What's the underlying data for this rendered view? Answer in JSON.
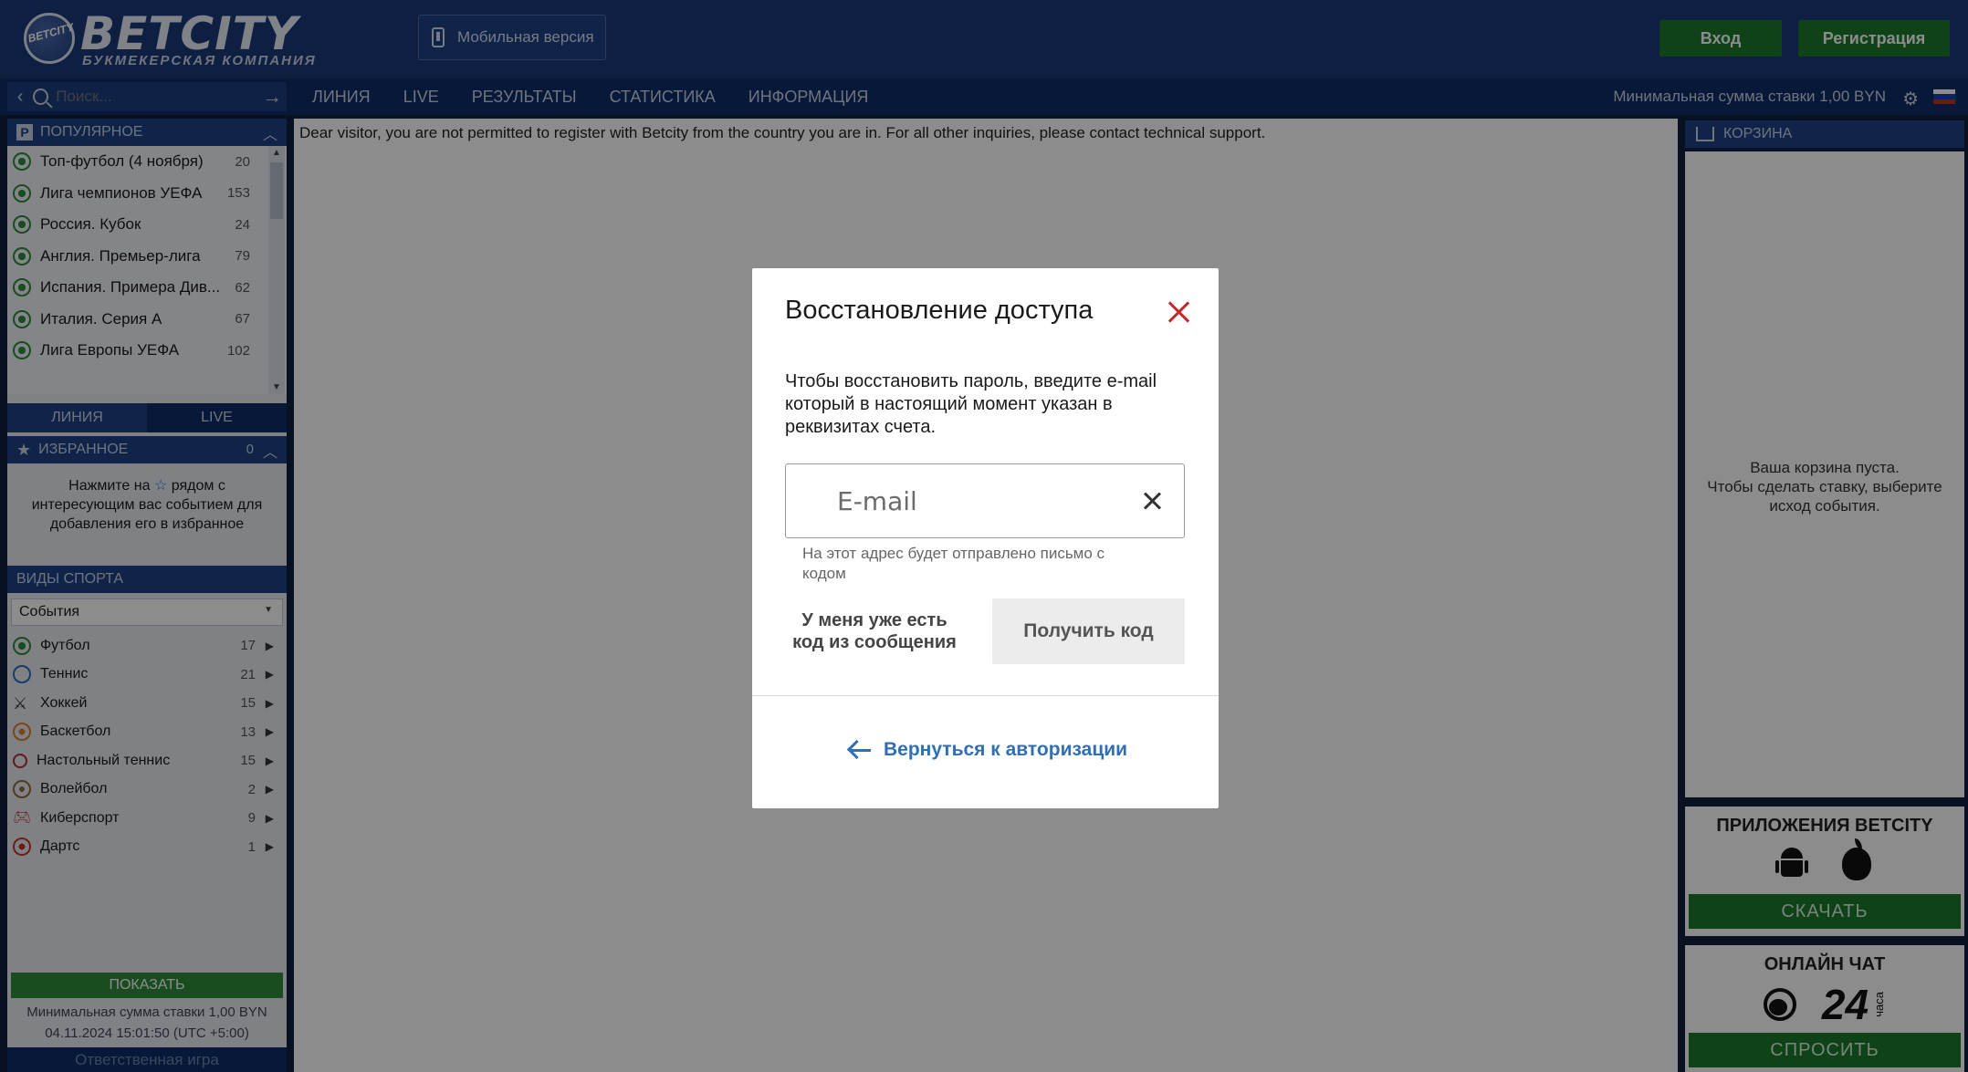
{
  "header": {
    "brand": "BETCITY",
    "tagline": "БУКМЕКЕРСКАЯ КОМПАНИЯ",
    "ball_text": "BETCITY",
    "mobile_version": "Мобильная версия",
    "login": "Вход",
    "register": "Регистрация"
  },
  "nav": {
    "search_placeholder": "Поиск...",
    "items": [
      "ЛИНИЯ",
      "LIVE",
      "РЕЗУЛЬТАТЫ",
      "СТАТИСТИКА",
      "ИНФОРМАЦИЯ"
    ],
    "min_bet": "Минимальная сумма ставки 1,00 BYN",
    "icons": [
      "gear-icon",
      "flag-ru-icon"
    ]
  },
  "popular": {
    "title": "ПОПУЛЯРНОЕ",
    "items": [
      {
        "label": "Топ-футбол (4 ноября)",
        "count": "20"
      },
      {
        "label": "Лига чемпионов УЕФА",
        "count": "153"
      },
      {
        "label": "Россия. Кубок",
        "count": "24"
      },
      {
        "label": "Англия. Премьер-лига",
        "count": "79"
      },
      {
        "label": "Испания. Примера Див...",
        "count": "62"
      },
      {
        "label": "Италия. Серия А",
        "count": "67"
      },
      {
        "label": "Лига Европы УЕФА",
        "count": "102"
      }
    ]
  },
  "tabs": {
    "line": "ЛИНИЯ",
    "live": "LIVE"
  },
  "favorites": {
    "title": "ИЗБРАННОЕ",
    "count": "0",
    "hint_1": "Нажмите на",
    "hint_2": "рядом с интересующим вас событием для добавления его в избранное"
  },
  "sports": {
    "title": "ВИДЫ СПОРТА",
    "select_value": "События",
    "items": [
      {
        "label": "Футбол",
        "count": "17",
        "color": "#2e8b3a"
      },
      {
        "label": "Теннис",
        "count": "21",
        "color": "#2f6fba"
      },
      {
        "label": "Хоккей",
        "count": "15",
        "color": "#333333"
      },
      {
        "label": "Баскетбол",
        "count": "13",
        "color": "#d9822b"
      },
      {
        "label": "Настольный теннис",
        "count": "15",
        "color": "#b03030"
      },
      {
        "label": "Волейбол",
        "count": "2",
        "color": "#8a6d3b"
      },
      {
        "label": "Киберспорт",
        "count": "9",
        "color": "#c0392b"
      },
      {
        "label": "Дартс",
        "count": "1",
        "color": "#c0392b"
      }
    ]
  },
  "left_footer": {
    "show": "ПОКАЗАТЬ",
    "min_bet": "Минимальная сумма ставки 1,00 BYN",
    "datetime": "04.11.2024 15:01:50 (UTC +5:00)",
    "responsible": "Ответственная игра"
  },
  "center": {
    "notice": "Dear visitor, you are not permitted to register with Betcity from the country you are in. For all other inquiries, please contact technical support."
  },
  "cart": {
    "title": "КОРЗИНА",
    "empty_1": "Ваша корзина пуста.",
    "empty_2": "Чтобы сделать ставку, выберите исход события."
  },
  "apps": {
    "title": "ПРИЛОЖЕНИЯ BETCITY",
    "download": "СКАЧАТЬ"
  },
  "chat": {
    "title": "ОНЛАЙН ЧАТ",
    "hours": "24",
    "hours_label": "часа",
    "ask": "СПРОСИТЬ"
  },
  "modal": {
    "title": "Восстановление доступа",
    "description": "Чтобы восстановить пароль, введите e-mail который в настоящий момент указан в реквизитах счета.",
    "email_placeholder": "E-mail",
    "email_value": "",
    "email_hint": "На этот адрес будет отправлено письмо с кодом",
    "have_code": "У меня уже есть код из сообщения",
    "get_code": "Получить код",
    "back": "Вернуться к авторизации"
  },
  "colors": {
    "header_bg": "#1a3a78",
    "green": "#1c7a2a",
    "link_blue": "#2f6fba",
    "close_red": "#c62828"
  }
}
